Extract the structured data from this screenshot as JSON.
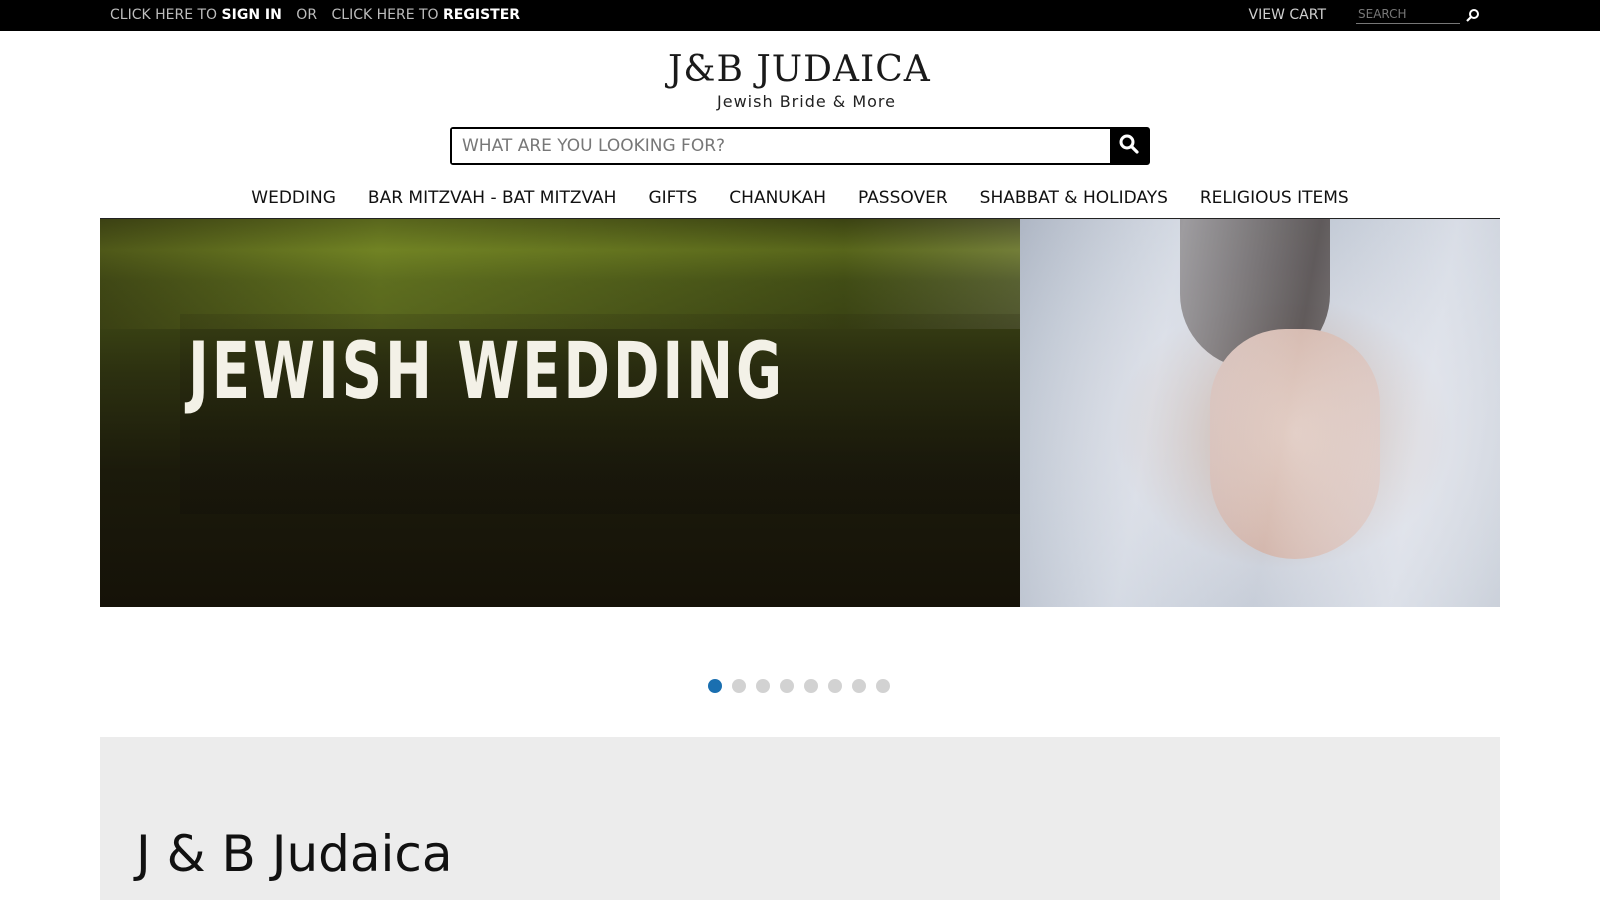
{
  "topbar": {
    "click_here_to_1": "CLICK HERE TO",
    "sign_in": "SIGN IN",
    "or": "OR",
    "click_here_to_2": "CLICK HERE TO",
    "register": "REGISTER",
    "view_cart": "VIEW CART",
    "search_placeholder": "SEARCH",
    "search_icon": "magnifier-icon"
  },
  "logo": {
    "line1": "J&B JUDAICA",
    "line2": "Jewish Bride & More"
  },
  "main_search": {
    "placeholder": "WHAT ARE YOU LOOKING FOR?",
    "button_icon": "search-icon"
  },
  "nav": {
    "items": [
      {
        "label": "WEDDING"
      },
      {
        "label": "BAR MITZVAH - BAT MITZVAH"
      },
      {
        "label": "GIFTS"
      },
      {
        "label": "CHANUKAH"
      },
      {
        "label": "PASSOVER"
      },
      {
        "label": "SHABBAT & HOLIDAYS"
      },
      {
        "label": "RELIGIOUS ITEMS"
      }
    ]
  },
  "hero": {
    "title": "JEWISH WEDDING"
  },
  "carousel": {
    "total_slides": 8,
    "active_index": 0,
    "active_color": "#1a6fb0",
    "inactive_color": "#d2d2d2"
  },
  "panel": {
    "heading": "J & B Judaica"
  }
}
